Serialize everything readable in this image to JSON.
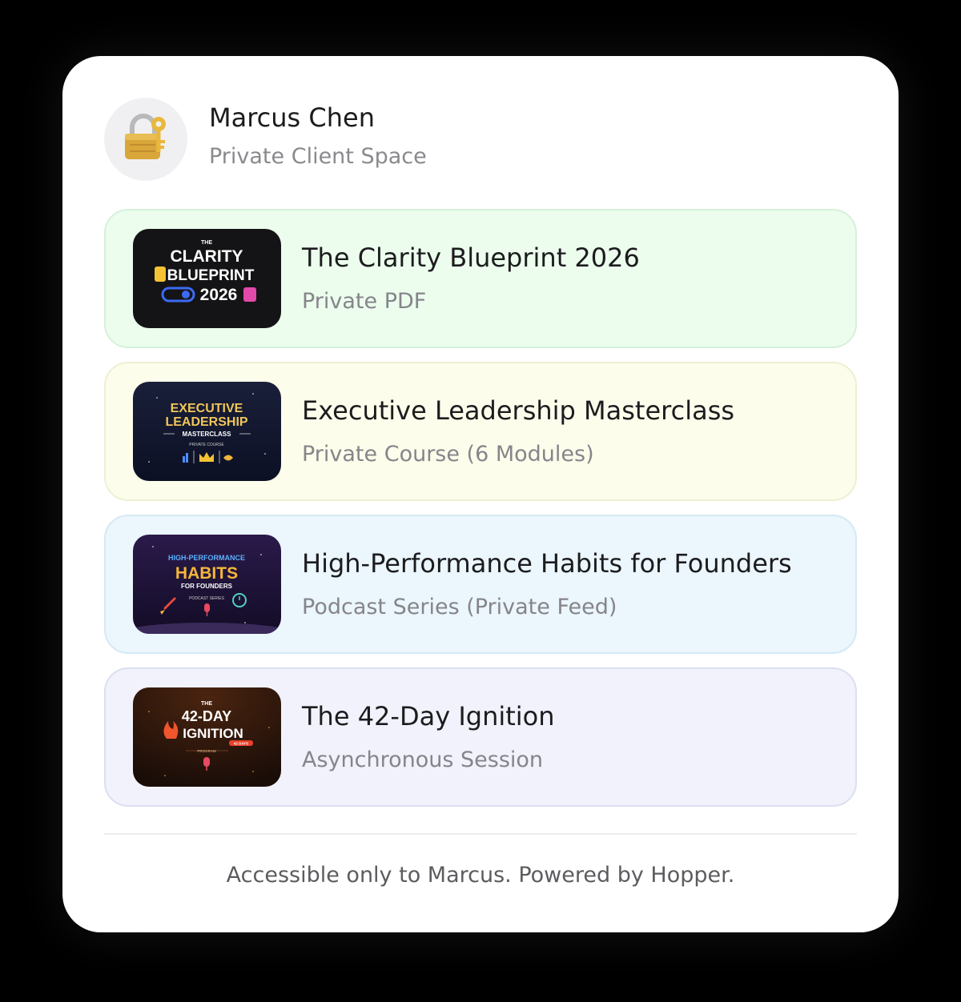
{
  "header": {
    "owner_name": "Marcus Chen",
    "space_label": "Private Client Space",
    "avatar_icon": "lock-key-icon"
  },
  "items": [
    {
      "title": "The Clarity Blueprint 2026",
      "subtitle": "Private PDF",
      "accent": "#ecfdee",
      "thumbnail": {
        "line1": "THE",
        "line2": "CLARITY",
        "line3": "BLUEPRINT",
        "line4": "2026"
      }
    },
    {
      "title": "Executive Leadership Masterclass",
      "subtitle": "Private Course (6 Modules)",
      "accent": "#fdfdec",
      "thumbnail": {
        "line1": "EXECUTIVE",
        "line2": "LEADERSHIP",
        "line3": "MASTERCLASS",
        "line4": "PRIVATE COURSE"
      }
    },
    {
      "title": "High-Performance Habits for Founders",
      "subtitle": "Podcast Series (Private Feed)",
      "accent": "#ebf6fd",
      "thumbnail": {
        "line1": "HIGH-PERFORMANCE",
        "line2": "HABITS",
        "line3": "FOR FOUNDERS",
        "line4": "PODCAST SERIES"
      }
    },
    {
      "title": "The 42-Day Ignition",
      "subtitle": "Asynchronous Session",
      "accent": "#f1f2fc",
      "thumbnail": {
        "line1": "THE",
        "line2": "42-DAY",
        "line3": "IGNITION",
        "line4": "PROGRAM",
        "badge": "42 DAYS"
      }
    }
  ],
  "footer": {
    "text": "Accessible only to Marcus. Powered by Hopper."
  }
}
